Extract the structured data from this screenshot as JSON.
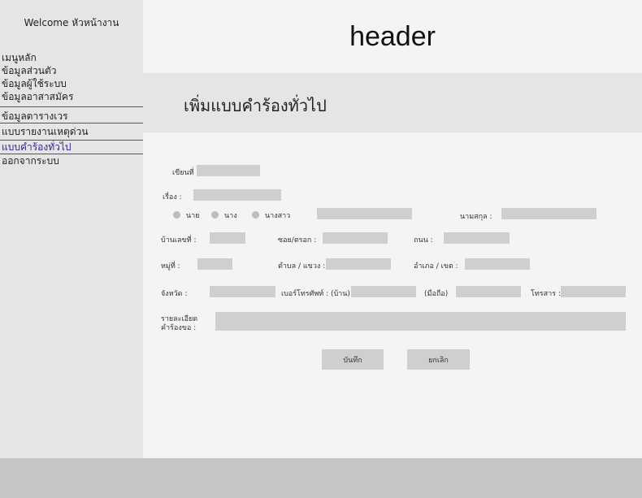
{
  "sidebar": {
    "welcome": "Welcome หัวหน้างาน",
    "items": [
      "เมนูหลัก",
      "ข้อมูลส่วนตัว",
      "ข้อมูลผู้ใช้ระบบ",
      "ข้อมูลอาสาสมัคร",
      "ข้อมูลตารางเวร",
      "แบบรายงานเหตุด่วน",
      "แบบคำร้องทั่วไป",
      "ออกจากระบบ"
    ]
  },
  "header": {
    "title": "header"
  },
  "page": {
    "title": "เพิ่มแบบคำร้องทั่วไป"
  },
  "form": {
    "written_at": "เขียนที่",
    "subject": "เรื่อง :",
    "prefix_mr": "นาย",
    "prefix_mrs": "นาง",
    "prefix_miss": "นางสาว",
    "surname": "นามสกุล :",
    "house_no": "บ้านเลขที่ :",
    "soi": "ซอย/ตรอก :",
    "road": "ถนน :",
    "moo": "หมู่ที่ :",
    "subdistrict": "ตำบล / แขวง :",
    "district": "อำเภอ / เขต :",
    "province": "จังหวัด :",
    "phone_home": "เบอร์โทรศัพท์ : (บ้าน)",
    "phone_mobile": "(มือถือ)",
    "fax": "โทรสาร :",
    "details_line1": "รายละเอียด",
    "details_line2": "คำร้องขอ :",
    "save": "บันทึก",
    "cancel": "ยกเลิก"
  }
}
